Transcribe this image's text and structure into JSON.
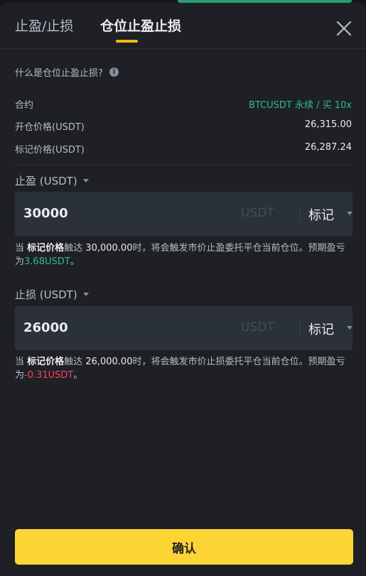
{
  "tabs": [
    {
      "label": "止盈/止损",
      "active": false
    },
    {
      "label": "仓位止盈止损",
      "active": true
    }
  ],
  "help_text": "什么是仓位止盈止损?",
  "info": [
    {
      "label": "合约",
      "value": "BTCUSDT 永续 / 买 10x"
    },
    {
      "label": "开仓价格(USDT)",
      "value": "26,315.00"
    },
    {
      "label": "标记价格(USDT)",
      "value": "26,287.24"
    }
  ],
  "take_profit": {
    "label": "止盈 (USDT)",
    "value": "30000",
    "unit": "USDT",
    "trigger_type": "标记",
    "desc": {
      "p1": "当 ",
      "price_type": "标记价格",
      "p2": "触达 ",
      "price": "30,000.00",
      "p3": "时，将会触发市价止盈委托平仓当前仓位。预期盈亏为",
      "pnl": "3.68USDT",
      "p4": "。"
    }
  },
  "stop_loss": {
    "label": "止损 (USDT)",
    "value": "26000",
    "unit": "USDT",
    "trigger_type": "标记",
    "desc": {
      "p1": "当 ",
      "price_type": "标记价格",
      "p2": "触达 ",
      "price": "26,000.00",
      "p3": "时，将会触发市价止损委托平仓当前仓位。预期盈亏为",
      "pnl": "-0.31USDT",
      "p4": "。"
    }
  },
  "confirm_label": "确认",
  "colors": {
    "accent": "#fcd535",
    "positive": "#2ebd85",
    "negative": "#f6465d",
    "background": "#1e2026"
  },
  "icons": {
    "close": "close-icon",
    "info": "info-icon",
    "dropdown": "caret-down-icon"
  }
}
